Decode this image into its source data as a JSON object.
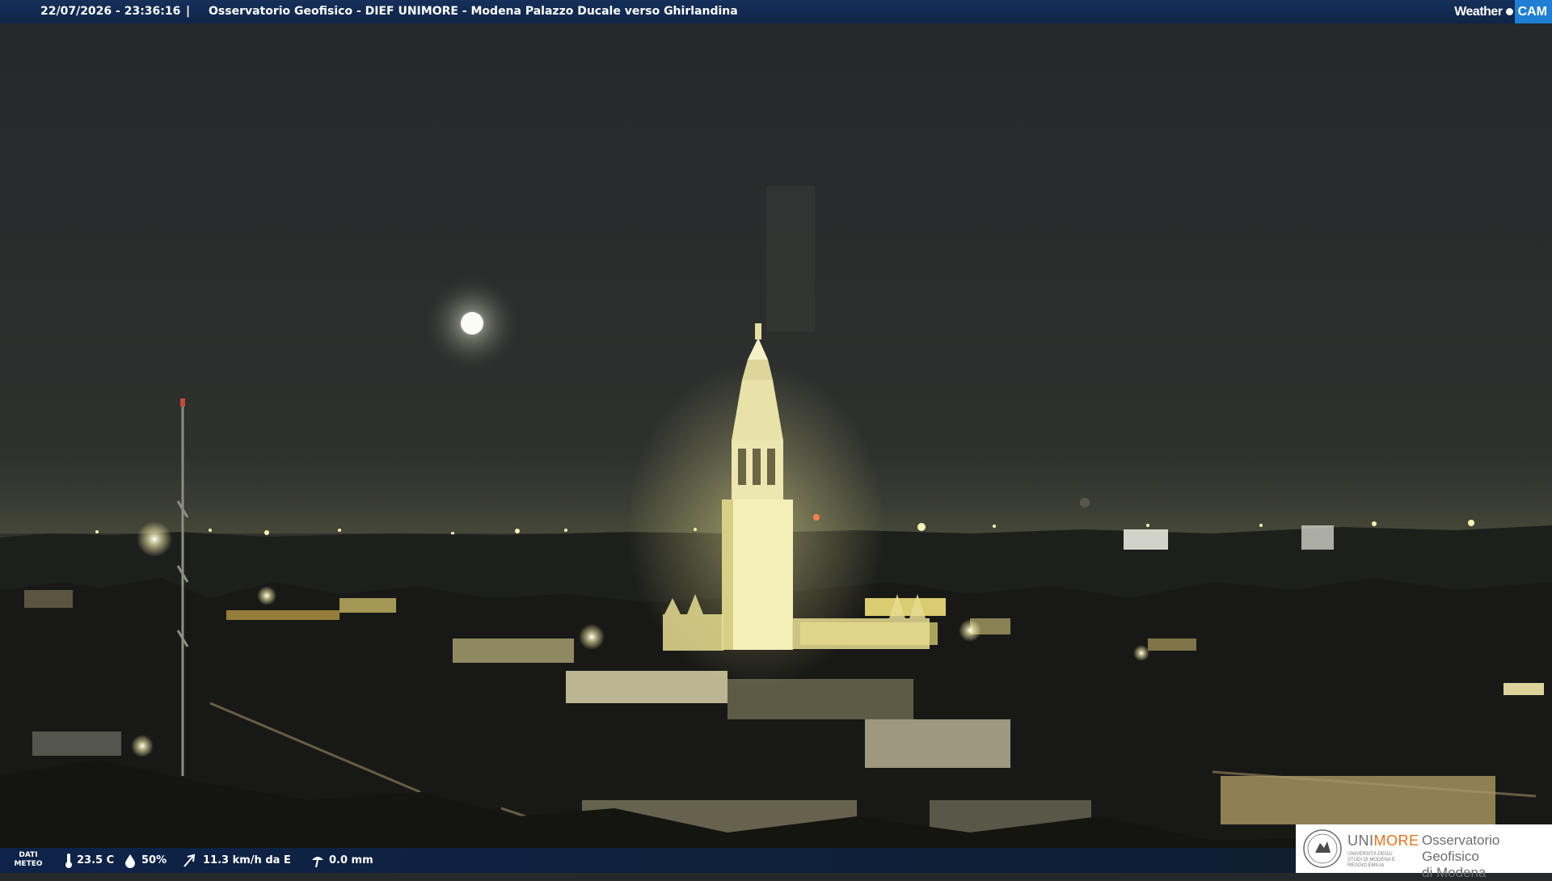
{
  "header": {
    "timestamp": "22/07/2026 - 23:36:16",
    "separator": "|",
    "caption": "Osservatorio Geofisico - DIEF UNIMORE - Modena Palazzo Ducale verso Ghirlandina",
    "brand_weather": "Weather",
    "brand_cam": "CAM"
  },
  "weather": {
    "section_label_line1": "DATI",
    "section_label_line2": "METEO",
    "temperature": "23.5 C",
    "humidity": "50%",
    "wind": "11.3 km/h da E",
    "rain": "0.0 mm",
    "icons": [
      "thermometer-icon",
      "humidity-drop-icon",
      "wind-icon",
      "rain-gauge-icon"
    ]
  },
  "logo": {
    "university_prefix": "UNI",
    "university_suffix": "MORE",
    "university_subtitle": "UNIVERSITÀ DEGLI STUDI DI MODENA E REGGIO EMILIA",
    "observatory_line1": "Osservatorio Geofisico",
    "observatory_line2": "di Modena"
  },
  "colors": {
    "header_bar": "#0f2447",
    "brand_accent": "#1f7fd4",
    "logo_orange": "#e8721c",
    "night_sky": "#2b2e2c",
    "tower_light": "#f6f2c4"
  }
}
